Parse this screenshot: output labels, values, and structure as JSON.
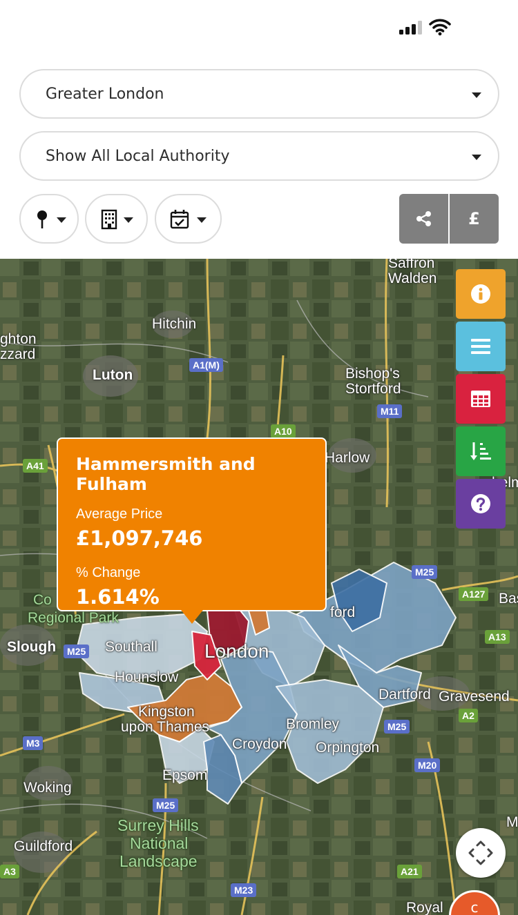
{
  "status_bar": {
    "signal_bars": 3,
    "wifi": true
  },
  "filters": {
    "region": {
      "selected": "Greater London"
    },
    "authority": {
      "selected": "Show All Local Authority"
    },
    "icons": [
      "pin-icon",
      "building-icon",
      "calendar-check-icon"
    ],
    "share_icon": "share-icon",
    "currency_label": "£"
  },
  "map": {
    "places": [
      "Saffron\nWalden",
      "Hitchin",
      "ghton\nzzard",
      "Luton",
      "Bishop's\nStortford",
      "Harlow",
      "Co",
      "Regional Park",
      "Slough",
      "Southall",
      "Hounslow",
      "London",
      "Kingston",
      "upon Thames",
      "Epsom",
      "Croydon",
      "Bromley",
      "Orpington",
      "Dartford",
      "Gravesend",
      "Bas",
      "Woking",
      "Guildford",
      "Surrey Hills",
      "National",
      "Landscape",
      "Royal",
      "M",
      "helm",
      "ford"
    ],
    "roads": [
      "A1(M)",
      "M11",
      "A10",
      "A41",
      "M25",
      "A127",
      "A13",
      "A2",
      "M25",
      "M20",
      "M3",
      "M25",
      "A21",
      "M23",
      "A3",
      "M25"
    ],
    "colors": {
      "dark_red": "#9b1b30",
      "red": "#d7263d",
      "orange": "#cf7a37",
      "light_blue": "#c7d7e4",
      "mid_blue": "#7da3c4",
      "dark_blue": "#3e6fa3"
    }
  },
  "tools": {
    "info_icon": "info-icon",
    "menu_icon": "list-icon",
    "table_icon": "table-icon",
    "sort_icon": "sort-icon",
    "help_icon": "help-icon",
    "colors": {
      "info": "#efa32c",
      "menu": "#5bc0de",
      "table": "#d9223f",
      "sort": "#28a545",
      "help": "#6a3fa0"
    }
  },
  "tooltip": {
    "title": "Hammersmith and Fulham",
    "price_label": "Average Price",
    "price_value": "£1,097,746",
    "change_label": "% Change",
    "change_value": "1.614%"
  },
  "recenter_icon": "recenter-arrows-icon",
  "corner_badge": {
    "label": "c"
  }
}
